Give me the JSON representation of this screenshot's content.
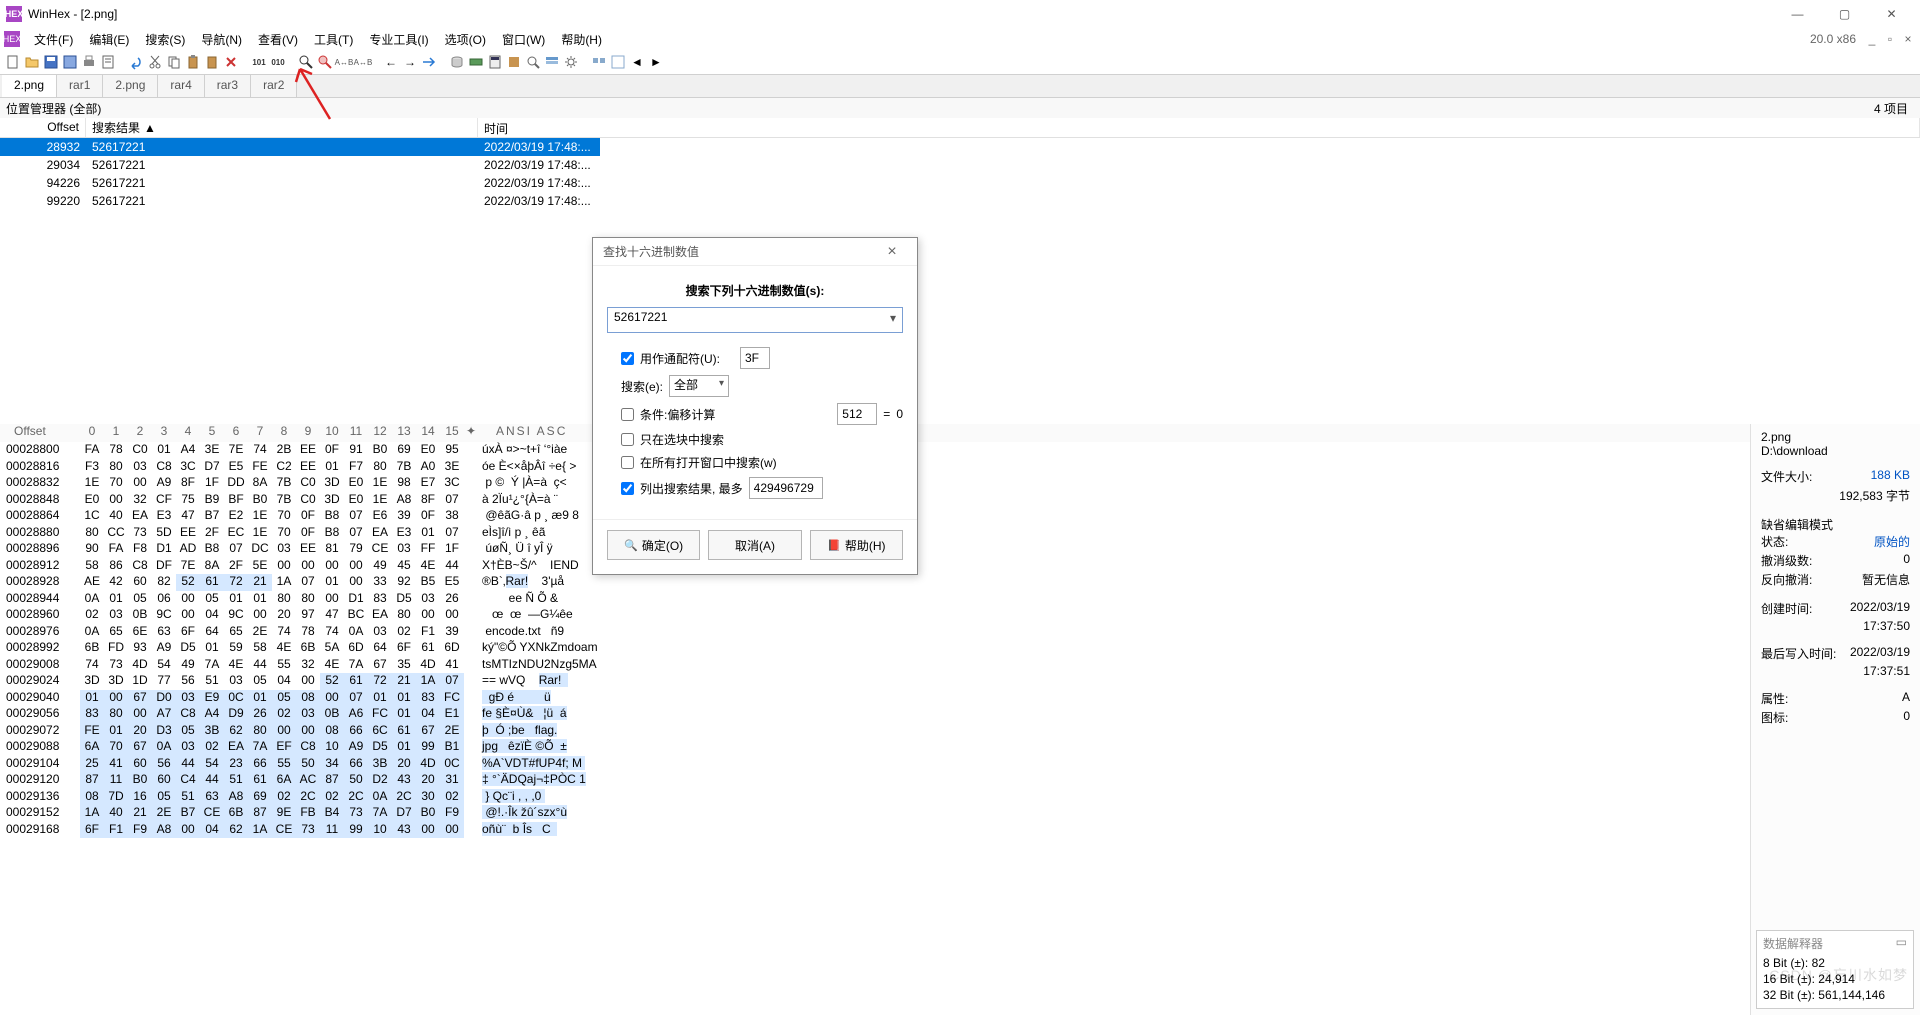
{
  "title": "WinHex - [2.png]",
  "version_label": "20.0 x86",
  "menus": [
    "文件(F)",
    "编辑(E)",
    "搜索(S)",
    "导航(N)",
    "查看(V)",
    "工具(T)",
    "专业工具(I)",
    "选项(O)",
    "窗口(W)",
    "帮助(H)"
  ],
  "tabs": [
    {
      "label": "2.png",
      "active": true
    },
    {
      "label": "rar1",
      "active": false
    },
    {
      "label": "2.png",
      "active": false
    },
    {
      "label": "rar4",
      "active": false
    },
    {
      "label": "rar3",
      "active": false
    },
    {
      "label": "rar2",
      "active": false
    }
  ],
  "loc_mgr_label": "位置管理器 (全部)",
  "loc_mgr_count": "4 项目",
  "result_headers": {
    "offset": "Offset",
    "result": "搜索结果",
    "time": "时间"
  },
  "results": [
    {
      "offset": "28932",
      "val": "52617221",
      "time": "2022/03/19  17:48:...",
      "sel": true
    },
    {
      "offset": "29034",
      "val": "52617221",
      "time": "2022/03/19  17:48:...",
      "sel": false
    },
    {
      "offset": "94226",
      "val": "52617221",
      "time": "2022/03/19  17:48:...",
      "sel": false
    },
    {
      "offset": "99220",
      "val": "52617221",
      "time": "2022/03/19  17:48:...",
      "sel": false
    }
  ],
  "hex_header": {
    "offset_label": "Offset",
    "cols": [
      "0",
      "1",
      "2",
      "3",
      "4",
      "5",
      "6",
      "7",
      "8",
      "9",
      "10",
      "11",
      "12",
      "13",
      "14",
      "15"
    ],
    "ascii_label": "ANSI ASC"
  },
  "hex_rows": [
    {
      "off": "00028800",
      "b": [
        "FA",
        "78",
        "C0",
        "01",
        "A4",
        "3E",
        "7E",
        "74",
        "2B",
        "EE",
        "0F",
        "91",
        "B0",
        "69",
        "E0",
        "95"
      ],
      "asc": "úxÀ ¤>~t+î ‘°iàe"
    },
    {
      "off": "00028816",
      "b": [
        "F3",
        "80",
        "03",
        "C8",
        "3C",
        "D7",
        "E5",
        "FE",
        "C2",
        "EE",
        "01",
        "F7",
        "80",
        "7B",
        "A0",
        "3E"
      ],
      "asc": "óe È<×åþÂî ÷e{ >"
    },
    {
      "off": "00028832",
      "b": [
        "1E",
        "70",
        "00",
        "A9",
        "8F",
        "1F",
        "DD",
        "8A",
        "7B",
        "C0",
        "3D",
        "E0",
        "1E",
        "98",
        "E7",
        "3C"
      ],
      "asc": " p ©  Ý |À=à  ç<"
    },
    {
      "off": "00028848",
      "b": [
        "E0",
        "00",
        "32",
        "CF",
        "75",
        "B9",
        "BF",
        "B0",
        "7B",
        "C0",
        "3D",
        "E0",
        "1E",
        "A8",
        "8F",
        "07"
      ],
      "asc": "à 2Ïu¹¿°{À=à ¨  "
    },
    {
      "off": "00028864",
      "b": [
        "1C",
        "40",
        "EA",
        "E3",
        "47",
        "B7",
        "E2",
        "1E",
        "70",
        "0F",
        "B8",
        "07",
        "E6",
        "39",
        "0F",
        "38"
      ],
      "asc": " @êãG·â p ¸ æ9 8"
    },
    {
      "off": "00028880",
      "b": [
        "80",
        "CC",
        "73",
        "5D",
        "EE",
        "2F",
        "EC",
        "1E",
        "70",
        "0F",
        "B8",
        "07",
        "EA",
        "E3",
        "01",
        "07"
      ],
      "asc": "eÌs]î/ì p ¸ êã  "
    },
    {
      "off": "00028896",
      "b": [
        "90",
        "FA",
        "F8",
        "D1",
        "AD",
        "B8",
        "07",
        "DC",
        "03",
        "EE",
        "81",
        "79",
        "CE",
        "03",
        "FF",
        "1F"
      ],
      "asc": " úøÑ­¸ Ü î yÎ ÿ "
    },
    {
      "off": "00028912",
      "b": [
        "58",
        "86",
        "C8",
        "DF",
        "7E",
        "8A",
        "2F",
        "5E",
        "00",
        "00",
        "00",
        "00",
        "49",
        "45",
        "4E",
        "44"
      ],
      "asc": "X†ÈB~Š/^    IEND"
    },
    {
      "off": "00028928",
      "b": [
        "AE",
        "42",
        "60",
        "82",
        "52",
        "61",
        "72",
        "21",
        "1A",
        "07",
        "01",
        "00",
        "33",
        "92",
        "B5",
        "E5"
      ],
      "asc": "®B`‚Rar!    3'µå",
      "hl": [
        4,
        5,
        6,
        7
      ],
      "ahl": [
        4,
        8
      ]
    },
    {
      "off": "00028944",
      "b": [
        "0A",
        "01",
        "05",
        "06",
        "00",
        "05",
        "01",
        "01",
        "80",
        "80",
        "00",
        "D1",
        "83",
        "D5",
        "03",
        "26"
      ],
      "asc": "        ee Ñ Õ &"
    },
    {
      "off": "00028960",
      "b": [
        "02",
        "03",
        "0B",
        "9C",
        "00",
        "04",
        "9C",
        "00",
        "20",
        "97",
        "47",
        "BC",
        "EA",
        "80",
        "00",
        "00"
      ],
      "asc": "   œ  œ  —G¼êe  "
    },
    {
      "off": "00028976",
      "b": [
        "0A",
        "65",
        "6E",
        "63",
        "6F",
        "64",
        "65",
        "2E",
        "74",
        "78",
        "74",
        "0A",
        "03",
        "02",
        "F1",
        "39"
      ],
      "asc": " encode.txt   ñ9"
    },
    {
      "off": "00028992",
      "b": [
        "6B",
        "FD",
        "93",
        "A9",
        "D5",
        "01",
        "59",
        "58",
        "4E",
        "6B",
        "5A",
        "6D",
        "64",
        "6F",
        "61",
        "6D"
      ],
      "asc": "ký\"©Õ YXNkZmdoam"
    },
    {
      "off": "00029008",
      "b": [
        "74",
        "73",
        "4D",
        "54",
        "49",
        "7A",
        "4E",
        "44",
        "55",
        "32",
        "4E",
        "7A",
        "67",
        "35",
        "4D",
        "41"
      ],
      "asc": "tsMTIzNDU2Nzg5MA"
    },
    {
      "off": "00029024",
      "b": [
        "3D",
        "3D",
        "1D",
        "77",
        "56",
        "51",
        "03",
        "05",
        "04",
        "00",
        "52",
        "61",
        "72",
        "21",
        "1A",
        "07"
      ],
      "asc": "== wVQ    Rar!  ",
      "hl": [
        10,
        11,
        12,
        13,
        14,
        15
      ],
      "ahl": [
        10,
        16
      ]
    },
    {
      "off": "00029040",
      "b": [
        "01",
        "00",
        "67",
        "D0",
        "03",
        "E9",
        "0C",
        "01",
        "05",
        "08",
        "00",
        "07",
        "01",
        "01",
        "83",
        "FC"
      ],
      "asc": "  gÐ é         ü",
      "hl": [
        0,
        1,
        2,
        3,
        4,
        5,
        6,
        7,
        8,
        9,
        10,
        11,
        12,
        13,
        14,
        15
      ]
    },
    {
      "off": "00029056",
      "b": [
        "83",
        "80",
        "00",
        "A7",
        "C8",
        "A4",
        "D9",
        "26",
        "02",
        "03",
        "0B",
        "A6",
        "FC",
        "01",
        "04",
        "E1"
      ],
      "asc": "fe §È¤Ù&   ¦ü  á",
      "hl": [
        0,
        1,
        2,
        3,
        4,
        5,
        6,
        7,
        8,
        9,
        10,
        11,
        12,
        13,
        14,
        15
      ]
    },
    {
      "off": "00029072",
      "b": [
        "FE",
        "01",
        "20",
        "D3",
        "05",
        "3B",
        "62",
        "80",
        "00",
        "00",
        "08",
        "66",
        "6C",
        "61",
        "67",
        "2E"
      ],
      "asc": "þ  Ó ;be   flag.",
      "hl": [
        0,
        1,
        2,
        3,
        4,
        5,
        6,
        7,
        8,
        9,
        10,
        11,
        12,
        13,
        14,
        15
      ]
    },
    {
      "off": "00029088",
      "b": [
        "6A",
        "70",
        "67",
        "0A",
        "03",
        "02",
        "EA",
        "7A",
        "EF",
        "C8",
        "10",
        "A9",
        "D5",
        "01",
        "99",
        "B1"
      ],
      "asc": "jpg   êzïÈ ©Õ  ±",
      "hl": [
        0,
        1,
        2,
        3,
        4,
        5,
        6,
        7,
        8,
        9,
        10,
        11,
        12,
        13,
        14,
        15
      ]
    },
    {
      "off": "00029104",
      "b": [
        "25",
        "41",
        "60",
        "56",
        "44",
        "54",
        "23",
        "66",
        "55",
        "50",
        "34",
        "66",
        "3B",
        "20",
        "4D",
        "0C"
      ],
      "asc": "%A`VDT#fUP4f; M ",
      "hl": [
        0,
        1,
        2,
        3,
        4,
        5,
        6,
        7,
        8,
        9,
        10,
        11,
        12,
        13,
        14,
        15
      ]
    },
    {
      "off": "00029120",
      "b": [
        "87",
        "11",
        "B0",
        "60",
        "C4",
        "44",
        "51",
        "61",
        "6A",
        "AC",
        "87",
        "50",
        "D2",
        "43",
        "20",
        "31"
      ],
      "asc": "‡ °`ÄDQaj¬‡PÒC 1",
      "hl": [
        0,
        1,
        2,
        3,
        4,
        5,
        6,
        7,
        8,
        9,
        10,
        11,
        12,
        13,
        14,
        15
      ]
    },
    {
      "off": "00029136",
      "b": [
        "08",
        "7D",
        "16",
        "05",
        "51",
        "63",
        "A8",
        "69",
        "02",
        "2C",
        "02",
        "2C",
        "0A",
        "2C",
        "30",
        "02"
      ],
      "asc": " } Qc¨i , , ,0 ",
      "hl": [
        0,
        1,
        2,
        3,
        4,
        5,
        6,
        7,
        8,
        9,
        10,
        11,
        12,
        13,
        14,
        15
      ]
    },
    {
      "off": "00029152",
      "b": [
        "1A",
        "40",
        "21",
        "2E",
        "B7",
        "CE",
        "6B",
        "87",
        "9E",
        "FB",
        "B4",
        "73",
        "7A",
        "D7",
        "B0",
        "F9"
      ],
      "asc": " @!.·Îk žû´szx°ù",
      "hl": [
        0,
        1,
        2,
        3,
        4,
        5,
        6,
        7,
        8,
        9,
        10,
        11,
        12,
        13,
        14,
        15
      ]
    },
    {
      "off": "00029168",
      "b": [
        "6F",
        "F1",
        "F9",
        "A8",
        "00",
        "04",
        "62",
        "1A",
        "CE",
        "73",
        "11",
        "99",
        "10",
        "43",
        "00",
        "00"
      ],
      "asc": "oñù¨  b Îs   C  ",
      "hl": [
        0,
        1,
        2,
        3,
        4,
        5,
        6,
        7,
        8,
        9,
        10,
        11,
        12,
        13,
        14,
        15
      ]
    }
  ],
  "right_panel": {
    "filename": "2.png",
    "path": "D:\\download",
    "size_label": "文件大小:",
    "size_value": "188 KB",
    "size_bytes": "192,583 字节",
    "mode_label": "缺省编辑模式",
    "state_label": "状态:",
    "state_value": "原始的",
    "undo_label": "撤消级数:",
    "undo_value": "0",
    "redo_label": "反向撤消:",
    "redo_value": "暂无信息",
    "created_label": "创建时间:",
    "created_value": "2022/03/19",
    "created_time": "17:37:50",
    "modified_label": "最后写入时间:",
    "modified_value": "2022/03/19",
    "modified_time": "17:37:51",
    "attr_label": "属性:",
    "attr_value": "A",
    "icon_label": "图标:",
    "icon_value": "0"
  },
  "interpreter": {
    "title": "数据解释器",
    "line1": "8 Bit (±): 82",
    "line2": "16 Bit (±): 24,914",
    "line3": "32 Bit (±): 561,144,146"
  },
  "dialog": {
    "title": "查找十六进制数值",
    "prompt": "搜索下列十六进制数值(s):",
    "value": "52617221",
    "wildcard_label": "用作通配符(U):",
    "wildcard_val": "3F",
    "wildcard_checked": true,
    "search_label": "搜索(e):",
    "search_scope": "全部",
    "cond_label": "条件:偏移计算",
    "cond_val": "512",
    "cond_eq": "=",
    "cond_res": "0",
    "cond_checked": false,
    "sel_label": "只在选块中搜索",
    "sel_checked": false,
    "allwin_label": "在所有打开窗口中搜索(w)",
    "allwin_checked": false,
    "listres_label": "列出搜索结果, 最多",
    "listres_val": "429496729",
    "listres_checked": true,
    "btn_ok": "确定(O)",
    "btn_cancel": "取消(A)",
    "btn_help": "帮助(H)"
  },
  "watermark": "CSDN @忘川水如梦"
}
